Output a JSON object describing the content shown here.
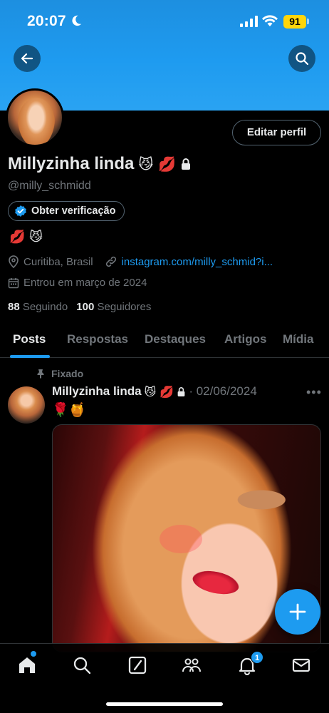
{
  "status_bar": {
    "time": "20:07",
    "battery": "91"
  },
  "profile": {
    "name": "Millyzinha linda",
    "name_emojis": "😼 💋",
    "handle": "@milly_schmidd",
    "edit_label": "Editar perfil",
    "verify_label": "Obter verificação",
    "bio": "💋 😼",
    "location": "Curitiba, Brasil",
    "link": "instagram.com/milly_schmid?i...",
    "joined": "Entrou em março de 2024",
    "following_count": "88",
    "following_label": "Seguindo",
    "followers_count": "100",
    "followers_label": "Seguidores"
  },
  "tabs": [
    {
      "label": "Posts",
      "active": true
    },
    {
      "label": "Respostas"
    },
    {
      "label": "Destaques"
    },
    {
      "label": "Artigos"
    },
    {
      "label": "Mídia"
    }
  ],
  "post": {
    "pinned_label": "Fixado",
    "author": "Millyzinha linda",
    "author_emojis": "😼 💋",
    "date": "· 02/06/2024",
    "text": "🌹🍯"
  },
  "bottom_nav": {
    "items": [
      "home-icon",
      "search-icon",
      "grok-icon",
      "communities-icon",
      "notifications-icon",
      "messages-icon"
    ],
    "notifications_badge": "1"
  },
  "colors": {
    "accent": "#1d9bf0",
    "banner": "#1e9bf0",
    "background": "#000000"
  }
}
